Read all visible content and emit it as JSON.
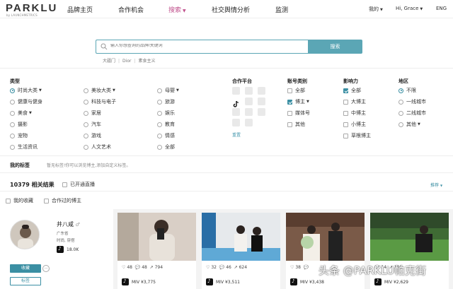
{
  "header": {
    "logo": "PARKLU",
    "logo_sub": "by LAUNCHMETRICS",
    "nav": [
      "品牌主页",
      "合作机会",
      "搜索",
      "社交舆情分析",
      "监测"
    ],
    "active_nav": "搜索",
    "my": "我的",
    "greeting": "Hi, Grace",
    "lang": "ENG"
  },
  "search": {
    "placeholder": "输入你想查询的品牌/关键词",
    "button": "搜索",
    "hot": [
      "大疆门",
      "Dior",
      "素食主义"
    ]
  },
  "filters": {
    "type_title": "类型",
    "type_options": [
      "时尚大类",
      "美妆大类",
      "母婴",
      "健康与健身",
      "科技与电子",
      "旅游",
      "美食",
      "家居",
      "娱乐",
      "摄影",
      "汽车",
      "教育",
      "宠物",
      "游戏",
      "情感",
      "生活资讯",
      "人文艺术",
      "全部"
    ],
    "platform_title": "合作平台",
    "reset": "重置",
    "account_title": "账号类别",
    "account_options": [
      "全部",
      "博主",
      "媒体号",
      "其他"
    ],
    "influence_title": "影响力",
    "influence_options": [
      "全部",
      "大博主",
      "中博主",
      "小博主",
      "草根博主"
    ],
    "region_title": "地区",
    "region_options": [
      "不限",
      "一线城市",
      "二线城市",
      "其他"
    ]
  },
  "my_tags": {
    "title": "我的标签",
    "text": "暂无标签!你可以浏览博主,添加自定义标签。"
  },
  "results": {
    "count_text": "10379 相关结果",
    "live_label": "已开通直播",
    "sort": "推荐",
    "my_fav": "我的收藏",
    "cooperated": "合作过的博主"
  },
  "profile": {
    "name": "井八咸",
    "gender_icon": "♂",
    "location": "广东省",
    "tags": "时尚, 穿搭",
    "followers": "18.0K",
    "fav_button": "收藏",
    "tag_button": "标签",
    "more": "···"
  },
  "posts": [
    {
      "likes": "48",
      "comments": "48",
      "shares": "794",
      "miv": "MIV ¥3,775"
    },
    {
      "likes": "32",
      "comments": "46",
      "shares": "624",
      "miv": "MIV ¥3,511"
    },
    {
      "likes": "38",
      "comments": "",
      "shares": "",
      "miv": "MIV ¥3,438"
    },
    {
      "likes": "",
      "comments": "14",
      "shares": "103",
      "miv": "MIV ¥2,629"
    }
  ],
  "watermark": "头条 @PARKLU帕克街",
  "colors": {
    "accent": "#5ba6b5",
    "active_nav": "#c0508c",
    "checked": "#3b8fa3"
  }
}
